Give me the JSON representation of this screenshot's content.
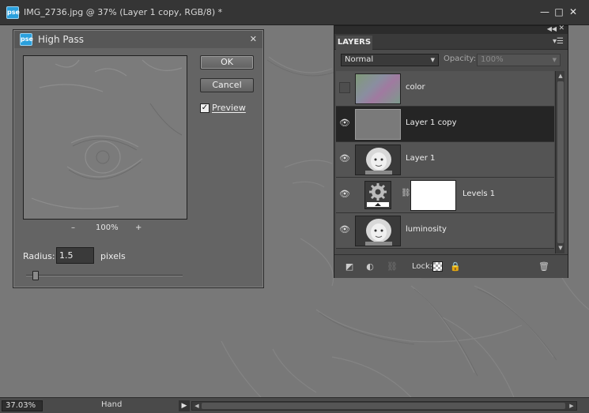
{
  "window": {
    "title": "IMG_2736.jpg @ 37% (Layer 1 copy, RGB/8) *",
    "app_badge": "pse",
    "minimize_glyph": "—",
    "maximize_glyph": "□",
    "close_glyph": "✕"
  },
  "status": {
    "zoom": "37.03%",
    "tool": "Hand",
    "arrow_glyph": "▶"
  },
  "dialog": {
    "title": "High Pass",
    "app_badge": "pse",
    "close_glyph": "✕",
    "ok_label": "OK",
    "cancel_label": "Cancel",
    "preview_label": "Preview",
    "preview_checked": true,
    "zoom_minus": "–",
    "zoom_plus": "+",
    "zoom_value": "100%",
    "radius_label": "Radius:",
    "radius_value": "1.5",
    "radius_unit": "pixels",
    "radius_slider_fraction": 0.06
  },
  "layers_panel": {
    "tab_label": "LAYERS",
    "blend_mode": "Normal",
    "opacity_label": "Opacity:",
    "opacity_value": "100%",
    "lock_label": "Lock:",
    "layers": [
      {
        "name": "color",
        "visible": false,
        "selected": false,
        "thumb": "color"
      },
      {
        "name": "Layer 1 copy",
        "visible": true,
        "selected": true,
        "thumb": "gray"
      },
      {
        "name": "Layer 1",
        "visible": true,
        "selected": false,
        "thumb": "photo"
      },
      {
        "name": "Levels 1",
        "visible": true,
        "selected": false,
        "thumb": "adjustment"
      },
      {
        "name": "luminosity",
        "visible": true,
        "selected": false,
        "thumb": "photo"
      }
    ]
  },
  "colors": {
    "accent": "#2aa0dd",
    "selected_row": "#252525",
    "canvas_gray": "#777777"
  },
  "icons": {
    "eye": "eye-icon",
    "trash": "trash-icon",
    "lock": "lock-icon",
    "link": "link-icon"
  }
}
